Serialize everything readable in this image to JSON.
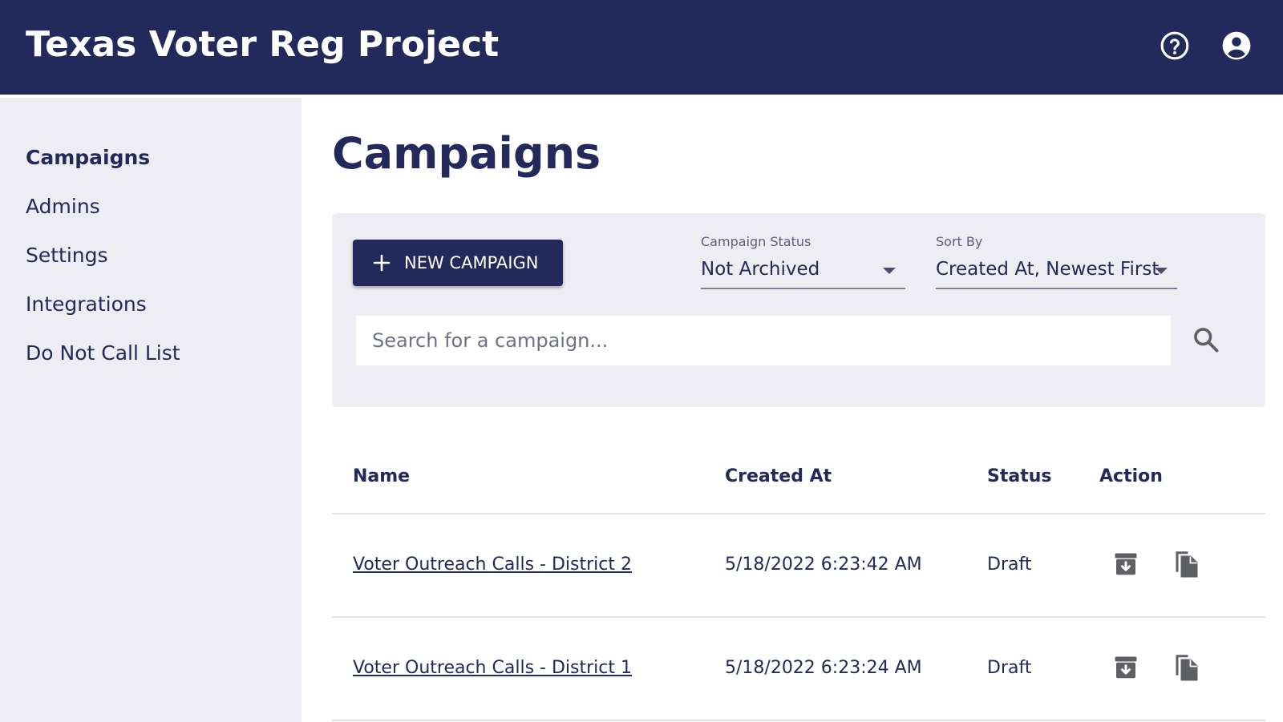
{
  "header": {
    "title": "Texas Voter Reg Project",
    "bg_color": "#23295a"
  },
  "sidebar": {
    "items": [
      {
        "label": "Campaigns",
        "active": true
      },
      {
        "label": "Admins"
      },
      {
        "label": "Settings"
      },
      {
        "label": "Integrations"
      },
      {
        "label": "Do Not Call List"
      }
    ]
  },
  "main": {
    "title": "Campaigns",
    "new_campaign_label": "NEW CAMPAIGN",
    "filters": {
      "status_label": "Campaign Status",
      "status_value": "Not Archived",
      "sort_label": "Sort By",
      "sort_value": "Created At, Newest First"
    },
    "search": {
      "placeholder": "Search for a campaign...",
      "value": ""
    },
    "table": {
      "columns": [
        "Name",
        "Created At",
        "Status",
        "Action"
      ],
      "rows": [
        {
          "name": "Voter Outreach Calls - District 2",
          "created_at": "5/18/2022 6:23:42 AM",
          "status": "Draft"
        },
        {
          "name": "Voter Outreach Calls - District 1",
          "created_at": "5/18/2022 6:23:24 AM",
          "status": "Draft"
        }
      ]
    }
  },
  "icons": {
    "help": "help-circle-icon",
    "account": "account-circle-icon",
    "plus": "plus-icon",
    "search": "search-icon",
    "archive": "archive-icon",
    "copy": "copy-icon"
  },
  "colors": {
    "primary": "#23295a",
    "panel": "#eeedf3",
    "icon_gray": "#5f6063"
  }
}
